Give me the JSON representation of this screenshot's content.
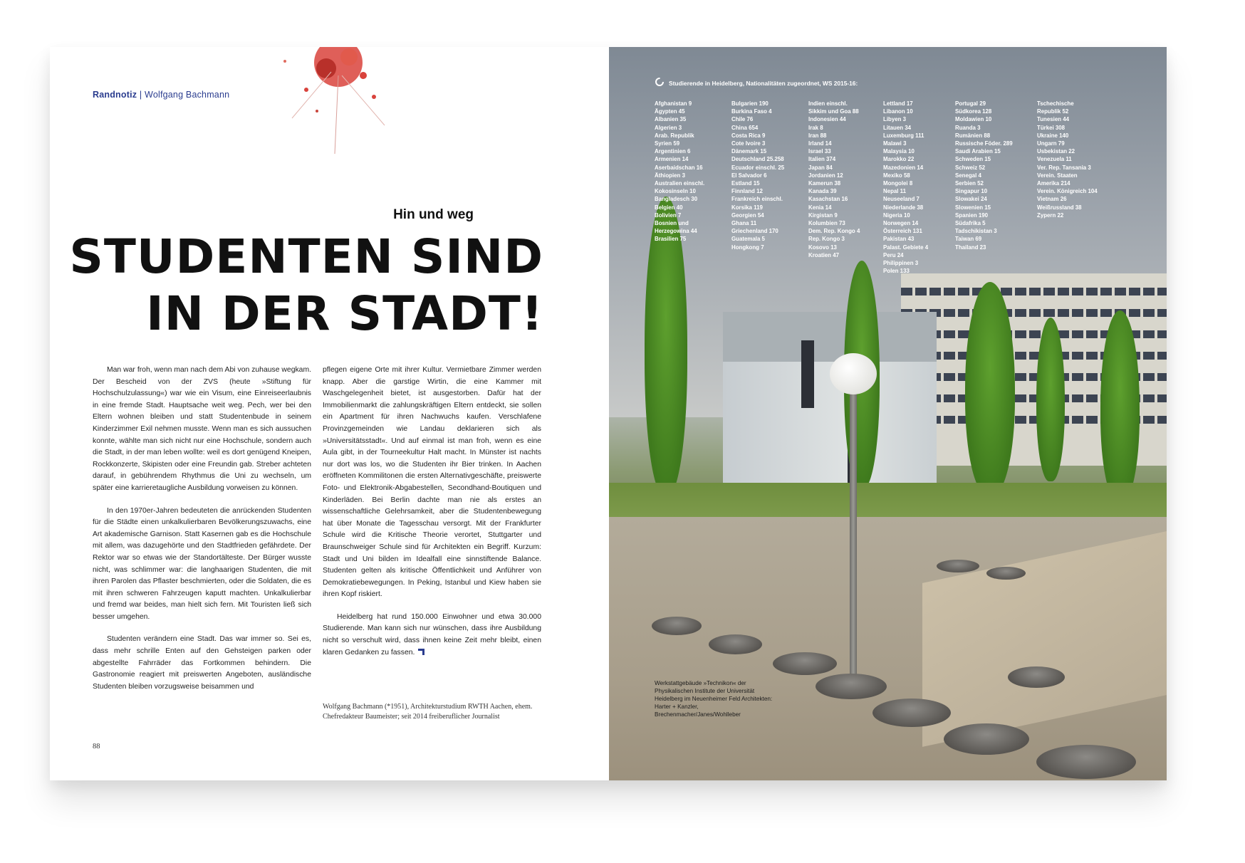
{
  "rubric": {
    "label": "Randnotiz",
    "separator": "|",
    "author": "Wolfgang Bachmann"
  },
  "kicker": "Hin und weg",
  "headline": {
    "line1": "STUDENTEN SIND",
    "line2": "IN DER STADT!"
  },
  "column1": [
    "Man war froh, wenn man nach dem Abi von zuhause wegkam. Der Bescheid von der ZVS (heute »Stiftung für Hochschulzulassung«) war wie ein Visum, eine Einreiseerlaubnis in eine fremde Stadt. Hauptsache weit weg. Pech, wer bei den Eltern wohnen bleiben und statt Studentenbude in seinem Kinderzimmer Exil nehmen musste. Wenn man es sich aussuchen konnte, wählte man sich nicht nur eine Hochschule, sondern auch die Stadt, in der man leben wollte: weil es dort genügend Kneipen, Rockkonzerte, Skipisten oder eine Freundin gab. Streber achteten darauf, in gebührendem Rhythmus die Uni zu wechseln, um später eine karrieretaugliche Ausbildung vorweisen zu können.",
    "In den 1970er-Jahren bedeuteten die anrückenden Studenten für die Städte einen unkalkulierbaren Bevölkerungszuwachs, eine Art akademische Garnison. Statt Kasernen gab es die Hochschule mit allem, was dazugehörte und den Stadtfrieden gefährdete. Der Rektor war so etwas wie der Standortälteste. Der Bürger wusste nicht, was schlimmer war: die langhaarigen Studenten, die mit ihren Parolen das Pflaster beschmierten, oder die Soldaten, die es mit ihren schweren Fahrzeugen kaputt machten. Unkalkulierbar und fremd war beides, man hielt sich fern. Mit Touristen ließ sich besser umgehen.",
    "Studenten verändern eine Stadt. Das war immer so. Sei es, dass mehr schrille Enten auf den Gehsteigen parken oder abgestellte Fahrräder das Fortkommen behindern. Die Gastronomie reagiert mit preiswerten Angeboten, ausländische Studenten bleiben vorzugsweise beisammen und"
  ],
  "column2": [
    "pflegen eigene Orte mit ihrer Kultur. Vermietbare Zimmer werden knapp. Aber die garstige Wirtin, die eine Kammer mit Waschgelegenheit bietet, ist ausgestorben. Dafür hat der Immobilienmarkt die zahlungskräftigen Eltern entdeckt, sie sollen ein Apartment für ihren Nachwuchs kaufen. Verschlafene Provinzgemeinden wie Landau deklarieren sich als »Universitätsstadt«. Und auf einmal ist man froh, wenn es eine Aula gibt, in der Tourneekultur Halt macht. In Münster ist nachts nur dort was los, wo die Studenten ihr Bier trinken. In Aachen eröffneten Kommilitonen die ersten Alternativgeschäfte, preiswerte Foto- und Elektronik-Abgabestellen, Secondhand-Boutiquen und Kinderläden. Bei Berlin dachte man nie als erstes an wissenschaftliche Gelehrsamkeit, aber die Studentenbewegung hat über Monate die Tagesschau versorgt. Mit der Frankfurter Schule wird die Kritische Theorie verortet, Stuttgarter und Braunschweiger Schule sind für Architekten ein Begriff. Kurzum: Stadt und Uni bilden im Idealfall eine sinnstiftende Balance. Studenten gelten als kritische Öffentlichkeit und Anführer von Demokratiebewegungen. In Peking, Istanbul und Kiew haben sie ihren Kopf riskiert.",
    "Heidelberg hat rund 150.000 Einwohner und etwa 30.000 Studierende. Man kann sich nur wünschen, dass ihre Ausbildung nicht so verschult wird, dass ihnen keine Zeit mehr bleibt, einen klaren Gedanken zu fassen."
  ],
  "author_bio": "Wolfgang Bachmann (*1951), Architekturstudium RWTH Aachen, ehem. Chefredakteur Baumeister; seit 2014 freiberuflicher Journalist",
  "page_number": "88",
  "stats": {
    "title": "Studierende in Heidelberg, Nationalitäten zugeordnet, WS 2015-16:",
    "columns": [
      [
        "Afghanistan 9",
        "Ägypten 45",
        "Albanien 35",
        "Algerien 3",
        "Arab. Republik",
        "Syrien 59",
        "Argentinien 6",
        "Armenien 14",
        "Aserbaidschan 16",
        "Äthiopien 3",
        "Australien einschl.",
        "Kokosinseln 10",
        "Bangladesch 30",
        "Belgien 40",
        "Bolivien 7",
        "Bosnien und",
        "Herzegowina 44",
        "Brasilien 75"
      ],
      [
        "Bulgarien 190",
        "Burkina Faso 4",
        "Chile 76",
        "China 654",
        "Costa Rica 9",
        "Cote Ivoire 3",
        "Dänemark 15",
        "Deutschland 25.258",
        "Ecuador einschl. 25",
        "El Salvador 6",
        "Estland 15",
        "Finnland 12",
        "Frankreich einschl.",
        "Korsika 119",
        "Georgien 54",
        "Ghana 11",
        "Griechenland 170",
        "Guatemala 5",
        "Hongkong 7"
      ],
      [
        "Indien einschl.",
        "Sikkim und Goa 88",
        "Indonesien 44",
        "Irak 8",
        "Iran 88",
        "Irland 14",
        "Israel 33",
        "Italien 374",
        "Japan 84",
        "Jordanien 12",
        "Kamerun 38",
        "Kanada 39",
        "Kasachstan 16",
        "Kenia 14",
        "Kirgistan 9",
        "Kolumbien 73",
        "Dem. Rep. Kongo 4",
        "Rep. Kongo 3",
        "Kosovo 13",
        "Kroatien 47"
      ],
      [
        "Lettland 17",
        "Libanon 10",
        "Libyen 3",
        "Litauen 34",
        "Luxemburg 111",
        "Malawi 3",
        "Malaysia 10",
        "Marokko 22",
        "Mazedonien 14",
        "Mexiko 58",
        "Mongolei 8",
        "Nepal 11",
        "Neuseeland 7",
        "Niederlande 38",
        "Nigeria 10",
        "Norwegen 14",
        "Österreich 131",
        "Pakistan 43",
        "Palast. Gebiete 4",
        "Peru 24",
        "Philippinen 3",
        "Polen 133"
      ],
      [
        "Portugal 29",
        "Südkorea 128",
        "Moldawien 10",
        "Ruanda 3",
        "Rumänien 88",
        "Russische Föder. 289",
        "Saudi Arabien 15",
        "Schweden 15",
        "Schweiz 52",
        "Senegal 4",
        "Serbien 52",
        "Singapur 10",
        "Slowakei 24",
        "Slowenien 15",
        "Spanien 190",
        "Südafrika 5",
        "Tadschikistan 3",
        "Taiwan 69",
        "Thailand 23"
      ],
      [
        "Tschechische",
        "Republik 52",
        "Tunesien 44",
        "Türkei 308",
        "Ukraine 140",
        "Ungarn 79",
        "Usbekistan 22",
        "Venezuela 11",
        "Ver. Rep. Tansania 3",
        "Verein. Staaten",
        "Amerika 214",
        "Verein. Königreich 104",
        "Vietnam 26",
        "Weißrussland 38",
        "Zypern 22"
      ]
    ]
  },
  "photo_caption": "Werkstattgebäude »Technikon« der Physikalischen Institute der Universität Heidelberg im Neuenheimer Feld Architekten: Harter + Kanzler, Brechenmacher/Janes/Wohlleber",
  "colors": {
    "accent_blue": "#2b3d8f",
    "headline": "#111111"
  }
}
